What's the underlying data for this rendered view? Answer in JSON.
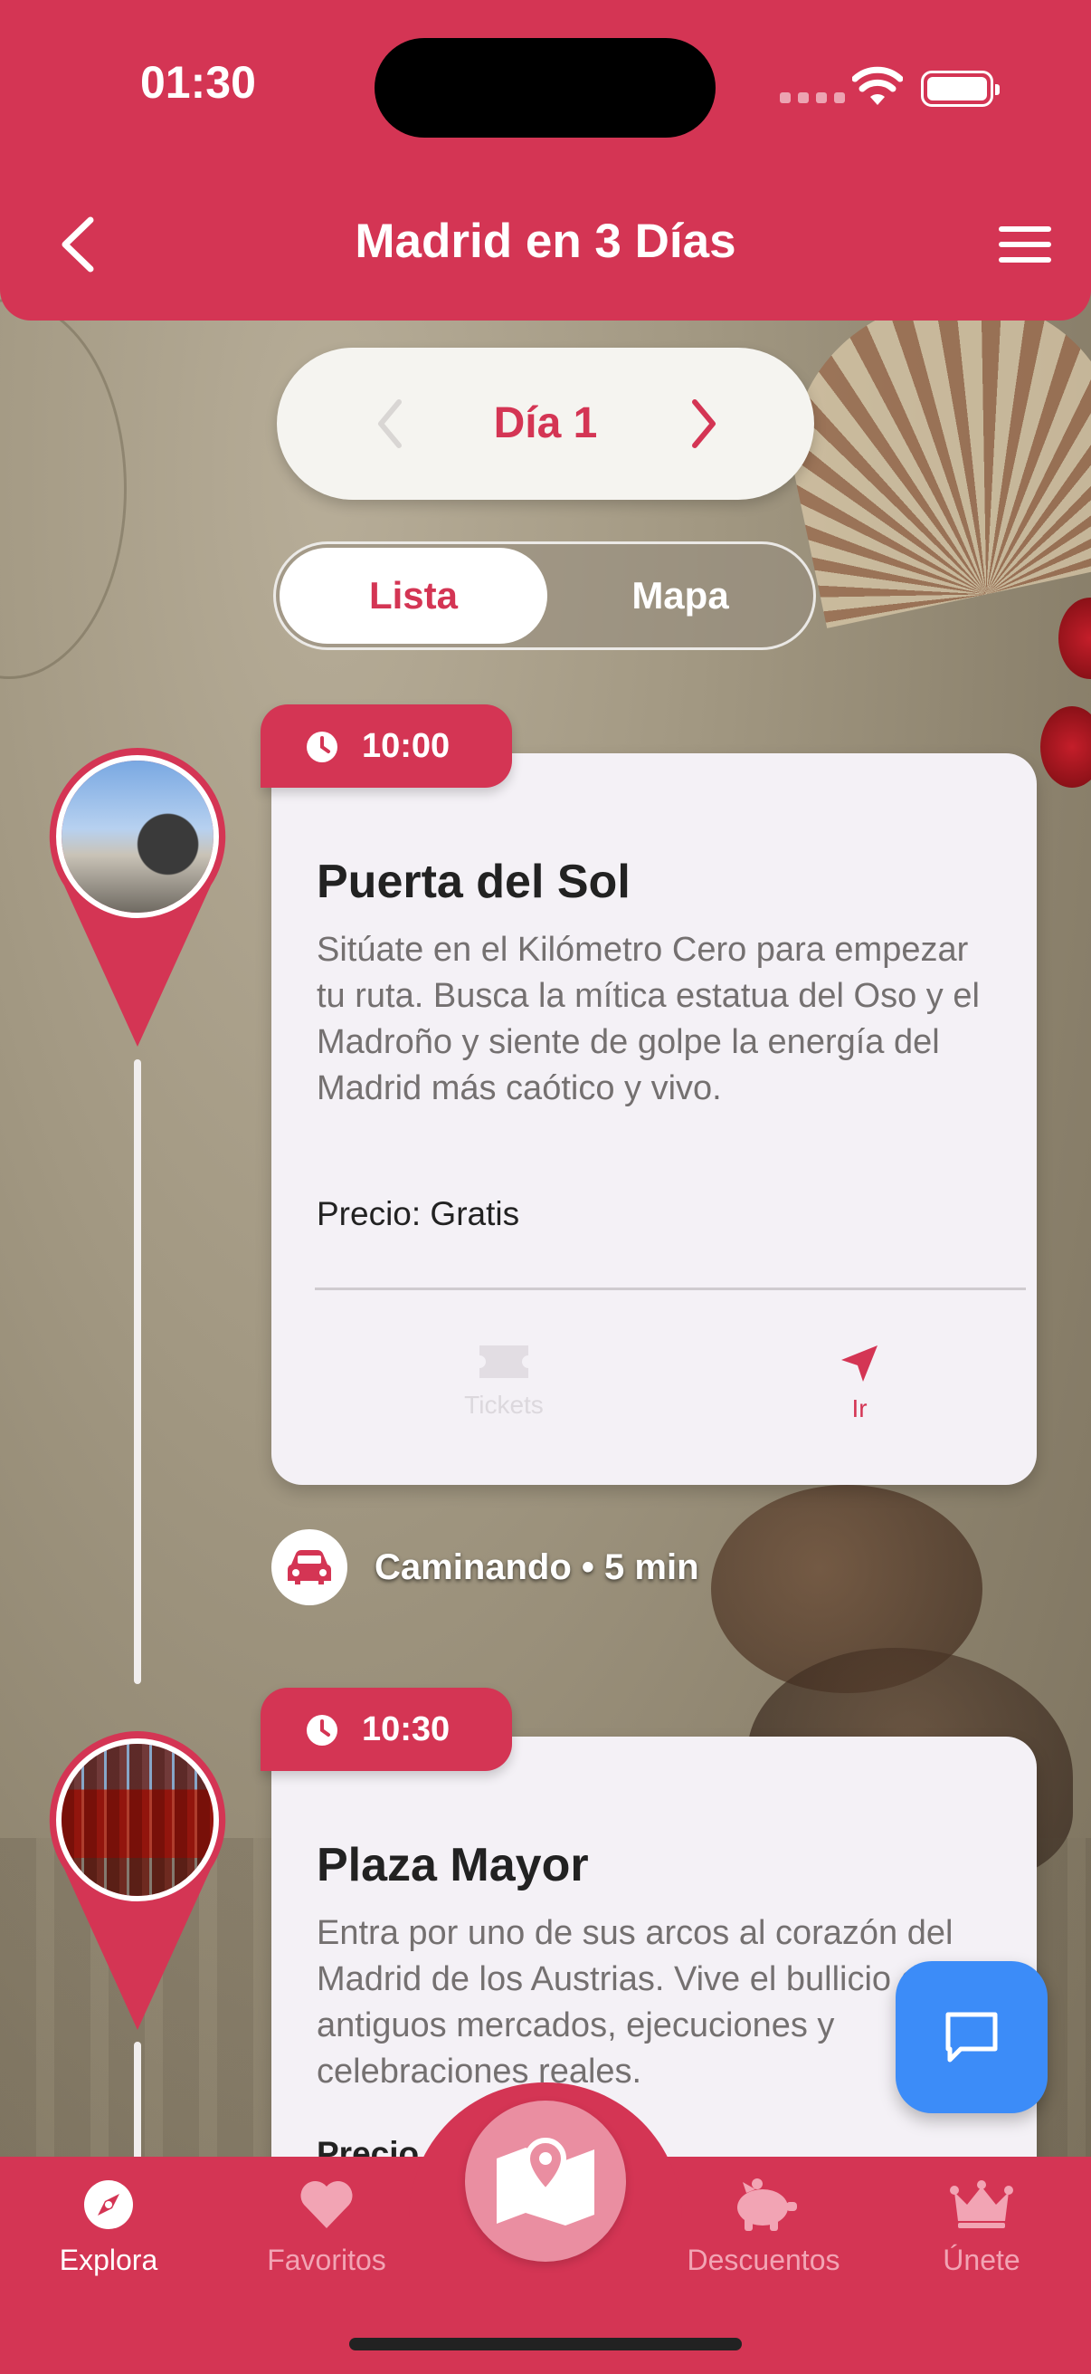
{
  "status_bar": {
    "time": "01:30"
  },
  "header": {
    "title": "Madrid en 3 Días"
  },
  "day_selector": {
    "label": "Día 1"
  },
  "view_toggle": {
    "active": "Lista",
    "inactive": "Mapa"
  },
  "stops": [
    {
      "time": "10:00",
      "title": "Puerta del Sol",
      "description": "Sitúate en el Kilómetro Cero para empezar tu ruta. Busca la mítica estatua del Oso y el Madroño y siente de golpe la energía del Madrid más caótico y vivo.",
      "price": "Precio: Gratis",
      "actions": {
        "tickets": "Tickets",
        "go": "Ir"
      }
    },
    {
      "time": "10:30",
      "title": "Plaza Mayor",
      "description": "Entra por uno de sus arcos al corazón del Madrid de los Austrias. Vive el bullicio de los antiguos mercados, ejecuciones y celebraciones reales.",
      "price": "Precio"
    }
  ],
  "transport": {
    "text": "Caminando • 5 min"
  },
  "bottom_nav": {
    "items": [
      "Explora",
      "Favoritos",
      "Descuentos",
      "Únete"
    ]
  },
  "colors": {
    "primary": "#d43554",
    "chat_fab": "#3c8cf8",
    "card_bg": "#f4f1f6",
    "nav_inactive": "#f2a4b4"
  },
  "icons": {
    "back": "chevron-left-icon",
    "menu": "hamburger-icon",
    "clock": "clock-icon",
    "tickets": "ticket-icon",
    "go": "navigation-arrow-icon",
    "transport": "car-icon",
    "chat": "chat-bubble-icon",
    "explora": "compass-icon",
    "favoritos": "heart-icon",
    "mapa": "map-pin-icon",
    "descuentos": "piggy-bank-icon",
    "unete": "crown-icon"
  }
}
